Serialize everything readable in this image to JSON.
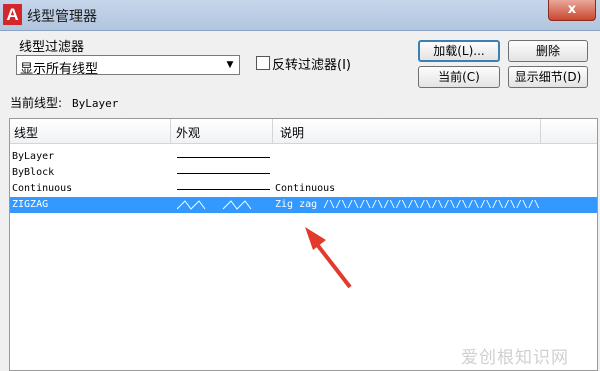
{
  "window": {
    "title": "线型管理器",
    "app_logo": "A",
    "close_glyph": "x"
  },
  "filter": {
    "label": "线型过滤器",
    "selected": "显示所有线型",
    "invert_checked": false,
    "invert_label": "反转过滤器(I)"
  },
  "buttons": {
    "load": "加载(L)...",
    "delete": "删除",
    "current": "当前(C)",
    "details": "显示细节(D)"
  },
  "current_linetype": {
    "label": "当前线型:",
    "value": "ByLayer"
  },
  "list": {
    "columns": [
      "线型",
      "外观",
      "说明"
    ],
    "rows": [
      {
        "name": "ByLayer",
        "appearance": "solid",
        "description": ""
      },
      {
        "name": "ByBlock",
        "appearance": "solid",
        "description": ""
      },
      {
        "name": "Continuous",
        "appearance": "solid",
        "description": "Continuous"
      },
      {
        "name": "ZIGZAG",
        "appearance": "zigzag",
        "description": "Zig zag /\\/\\/\\/\\/\\/\\/\\/\\/\\/\\/\\/\\/\\/\\/\\/\\/\\/\\/\\/\\/\\/\\",
        "selected": true
      }
    ]
  },
  "annotation": {
    "arrow_color": "#e23b2e"
  },
  "watermark": "爱创根知识网"
}
